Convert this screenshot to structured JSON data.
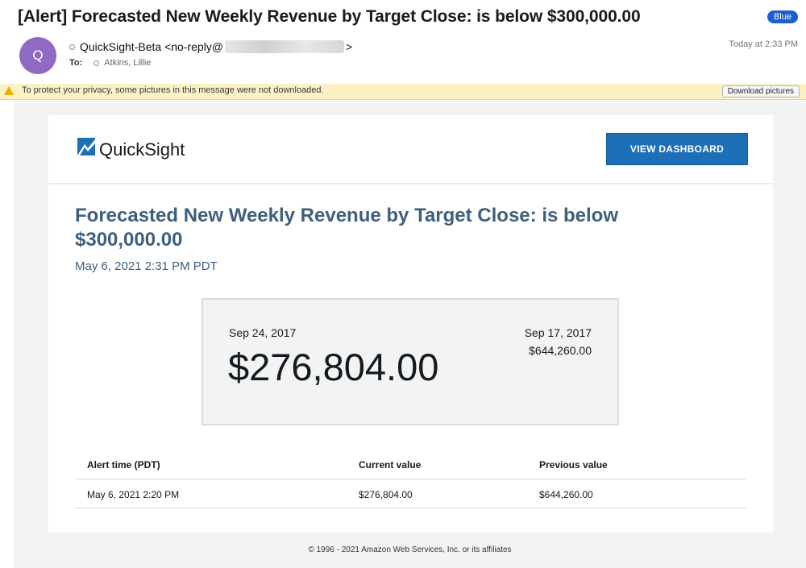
{
  "email": {
    "subject": "[Alert] Forecasted New Weekly Revenue by Target Close: is below $300,000.00",
    "tag": "Blue",
    "avatar_initial": "Q",
    "from_prefix": "QuickSight-Beta <no-reply@",
    "from_suffix": ">",
    "to_label": "To:",
    "to_name": "Atkins, Lillie",
    "time": "Today at 2:33 PM"
  },
  "privacy": {
    "message": "To protect your privacy, some pictures in this message were not downloaded.",
    "button": "Download pictures"
  },
  "card": {
    "brand": "QuickSight",
    "view_button": "VIEW DASHBOARD",
    "title": "Forecasted New Weekly Revenue by Target Close: is below $300,000.00",
    "date": "May 6, 2021 2:31 PM PDT",
    "kpi": {
      "current_date": "Sep 24, 2017",
      "current_value": "$276,804.00",
      "previous_date": "Sep 17, 2017",
      "previous_value": "$644,260.00"
    },
    "table": {
      "headers": [
        "Alert time (PDT)",
        "Current value",
        "Previous value"
      ],
      "rows": [
        [
          "May 6, 2021 2:20 PM",
          "$276,804.00",
          "$644,260.00"
        ]
      ]
    }
  },
  "footer": "© 1996 - 2021 Amazon Web Services, Inc. or its affiliates",
  "colors": {
    "accent": "#1d6fb8",
    "title": "#3f5f7d",
    "avatar": "#8d6bc2",
    "tag": "#1d5fd3",
    "warning_bar": "#fbf1c4"
  }
}
